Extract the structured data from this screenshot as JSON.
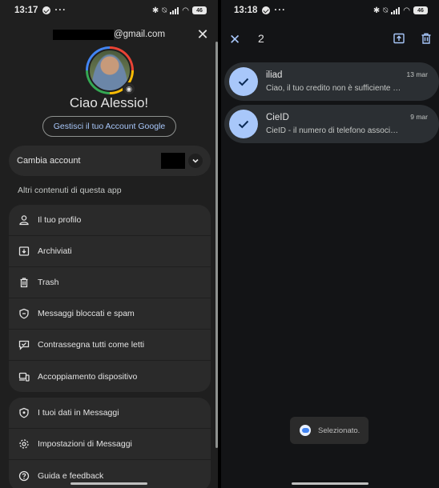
{
  "left": {
    "status": {
      "time": "13:17",
      "dots": "···",
      "battery": "46"
    },
    "account": {
      "email_suffix": "@gmail.com",
      "greeting": "Ciao Alessio!",
      "manage_label": "Gestisci il tuo Account Google",
      "switch_label": "Cambia account"
    },
    "section_label": "Altri contenuti di questa app",
    "menu_group_1": [
      {
        "label": "Il tuo profilo",
        "icon": "person-icon"
      },
      {
        "label": "Archiviati",
        "icon": "archive-icon"
      },
      {
        "label": "Trash",
        "icon": "trash-icon"
      },
      {
        "label": "Messaggi bloccati e spam",
        "icon": "shield-icon"
      },
      {
        "label": "Contrassegna tutti come letti",
        "icon": "mark-read-icon"
      },
      {
        "label": "Accoppiamento dispositivo",
        "icon": "devices-icon"
      }
    ],
    "menu_group_2": [
      {
        "label": "I tuoi dati in Messaggi",
        "icon": "data-shield-icon"
      },
      {
        "label": "Impostazioni di Messaggi",
        "icon": "gear-icon"
      },
      {
        "label": "Guida e feedback",
        "icon": "help-icon"
      }
    ]
  },
  "right": {
    "status": {
      "time": "13:18",
      "dots": "···",
      "battery": "46"
    },
    "header": {
      "selected_count": "2"
    },
    "conversations": [
      {
        "name": "iliad",
        "snippet": "Ciao, il tuo credito non è sufficiente p...",
        "date": "13 mar",
        "selected": true
      },
      {
        "name": "CieID",
        "snippet": "CieID - il numero di telefono associato...",
        "date": "9 mar",
        "selected": true
      }
    ],
    "toast": "Selezionato."
  },
  "colors": {
    "accent": "#a8c7fa",
    "background": "#1f1f1f",
    "surface": "#2a2a2a"
  }
}
